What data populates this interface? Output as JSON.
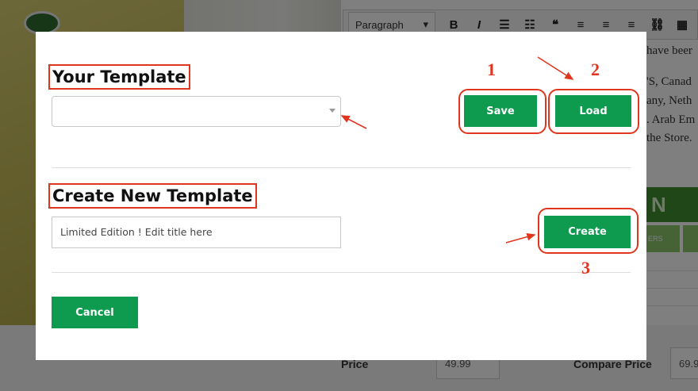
{
  "background": {
    "editor_format": "Paragraph",
    "body_lines": [
      "have beer",
      "'S, Canad",
      "any, Neth",
      ". Arab Em",
      "the Store."
    ],
    "banner_letter": "N",
    "tab_label": "ERS",
    "price_label": "Price",
    "price_value": "49.99",
    "compare_label": "Compare Price",
    "compare_value": "69.9"
  },
  "modal": {
    "your_template_heading": "Your Template",
    "template_select_value": "",
    "save_label": "Save",
    "load_label": "Load",
    "create_heading": "Create New Template",
    "title_input_value": "Limited Edition ! Edit title here",
    "create_label": "Create",
    "cancel_label": "Cancel"
  },
  "annotations": {
    "step1": "1",
    "step2": "2",
    "step3": "3",
    "color": "#e0361f"
  },
  "colors": {
    "accent_green": "#0f9b4f",
    "annotation_red": "#e0361f"
  }
}
